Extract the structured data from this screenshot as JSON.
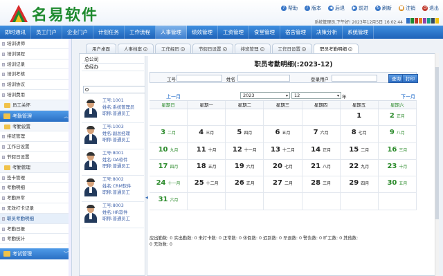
{
  "app": {
    "logo_text": "名易软件"
  },
  "toolbar": {
    "items": [
      {
        "label": "帮助",
        "icon": "help-icon"
      },
      {
        "label": "版本",
        "icon": "info-icon"
      },
      {
        "label": "后退",
        "icon": "back-icon"
      },
      {
        "label": "前进",
        "icon": "forward-icon"
      },
      {
        "label": "刷新",
        "icon": "refresh-icon"
      },
      {
        "label": "注销",
        "icon": "lock-icon"
      },
      {
        "label": "退出",
        "icon": "power-icon"
      }
    ],
    "status": "系统管理员,下午好!   2023年12月5日 16:02:44",
    "palette_colors": [
      "#2f6fc4",
      "#1e8a2e",
      "#c0392b",
      "#e67e22",
      "#8e44ad",
      "#16a085",
      "#34495e",
      "#f1c40f"
    ]
  },
  "menu": {
    "items": [
      "即时通讯",
      "员工门户",
      "企业门户",
      "计划任务",
      "工作流程",
      "人事管理",
      "绩效管理",
      "工资管理",
      "食堂管理",
      "宿舍管理",
      "决策分析",
      "系统管理"
    ],
    "active_index": 5
  },
  "sidebar": {
    "top_items": [
      "培训讲师",
      "培训课程",
      "培训记录",
      "培训考核",
      "培训协议",
      "培训费用"
    ],
    "group1": "员工关怀",
    "group2": "考勤管理",
    "sub1": "考勤设置",
    "sub1_items": [
      "排班管理",
      "工作日设置",
      "节假日设置"
    ],
    "sub2": "考勤管理",
    "sub2_items": [
      "签卡管理",
      "考勤明细",
      "考勤异常",
      "无效打卡记录",
      "职员考勤明细",
      "考勤日报",
      "考勤统计"
    ],
    "selected": "职员考勤明细",
    "group3": "考试管理"
  },
  "tabs": [
    {
      "label": "用户桌面",
      "closable": false
    },
    {
      "label": "人事档案",
      "closable": true
    },
    {
      "label": "工作经历",
      "closable": true
    },
    {
      "label": "节假日设置",
      "closable": true
    },
    {
      "label": "排班管理",
      "closable": true
    },
    {
      "label": "工作日设置",
      "closable": true
    },
    {
      "label": "职员考勤明细",
      "closable": true
    }
  ],
  "org": {
    "nodes": [
      "总公司",
      "总经办"
    ]
  },
  "employees": [
    {
      "id": "工号:1001",
      "name": "姓名:系统管理员",
      "title": "职称:普通员工"
    },
    {
      "id": "工号:1003",
      "name": "姓名:副总经理",
      "title": "职称:普通员工"
    },
    {
      "id": "工号:8001",
      "name": "姓名:OA软件",
      "title": "职称:普通员工"
    },
    {
      "id": "工号:8002",
      "name": "姓名:CRM软件",
      "title": "职称:普通员工"
    },
    {
      "id": "工号:8003",
      "name": "姓名:HR软件",
      "title": "职称:普通员工"
    }
  ],
  "calendar": {
    "title": "职员考勤明细(:2023-12)",
    "filter": {
      "job_no_label": "工号",
      "name_label": "姓名",
      "login_label": "登录用户",
      "query_button": "查询",
      "print_button": "打印"
    },
    "prev": "上一月",
    "next": "下一月",
    "year": "2023",
    "month": "12",
    "year_suffix": "年",
    "weekdays": [
      "星期日",
      "星期一",
      "星期二",
      "星期三",
      "星期四",
      "星期五",
      "星期六"
    ],
    "weeks": [
      [
        [
          "",
          ""
        ],
        [
          "",
          ""
        ],
        [
          "",
          ""
        ],
        [
          "",
          ""
        ],
        [
          "",
          ""
        ],
        [
          "1",
          ""
        ],
        [
          "2",
          "正月"
        ]
      ],
      [
        [
          "3",
          "二月"
        ],
        [
          "4",
          "三月"
        ],
        [
          "5",
          "四月"
        ],
        [
          "6",
          "五月"
        ],
        [
          "7",
          "六月"
        ],
        [
          "8",
          "七月"
        ],
        [
          "9",
          "八月"
        ]
      ],
      [
        [
          "10",
          "九月"
        ],
        [
          "11",
          "十月"
        ],
        [
          "12",
          "十一月"
        ],
        [
          "13",
          "十二月"
        ],
        [
          "14",
          "正月"
        ],
        [
          "15",
          "二月"
        ],
        [
          "16",
          "三月"
        ]
      ],
      [
        [
          "17",
          "四月"
        ],
        [
          "18",
          "五月"
        ],
        [
          "19",
          "六月"
        ],
        [
          "20",
          "七月"
        ],
        [
          "21",
          "八月"
        ],
        [
          "22",
          "九月"
        ],
        [
          "23",
          "十月"
        ]
      ],
      [
        [
          "24",
          "十一月"
        ],
        [
          "25",
          "十二月"
        ],
        [
          "26",
          "正月"
        ],
        [
          "27",
          "二月"
        ],
        [
          "28",
          "三月"
        ],
        [
          "29",
          "四月"
        ],
        [
          "30",
          "五月"
        ]
      ],
      [
        [
          "31",
          "六月"
        ],
        [
          "",
          ""
        ],
        [
          "",
          ""
        ],
        [
          "",
          ""
        ],
        [
          "",
          ""
        ],
        [
          "",
          ""
        ],
        [
          "",
          ""
        ]
      ]
    ]
  },
  "summary": {
    "line1": "应出勤数:  0     实出勤数: 0     未打卡数: 0     正常数:  0     休假数:  0     迟到数: 0     早退数: 0     警告数: 0     旷工数: 0     其他数:",
    "line2": "0     无效数: 0"
  }
}
